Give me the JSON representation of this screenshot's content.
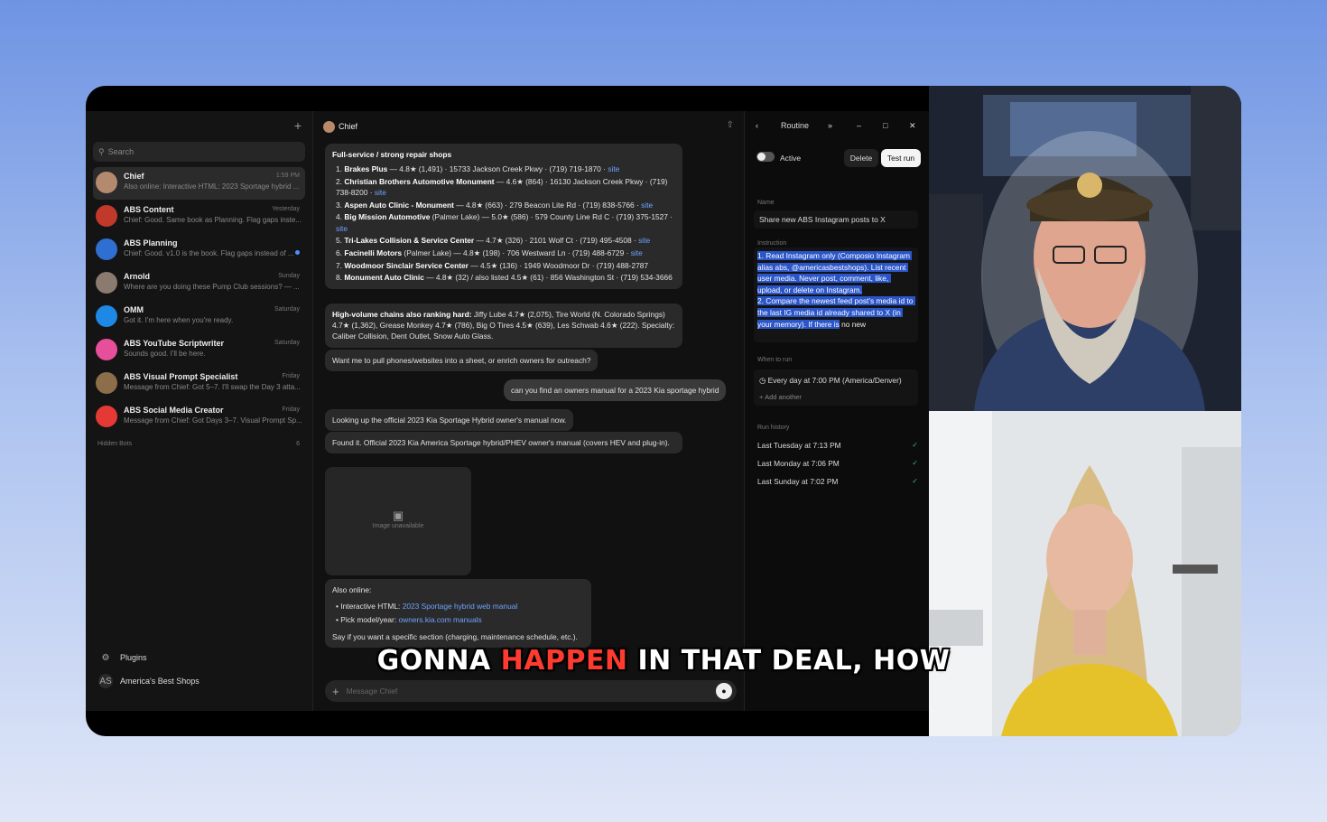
{
  "sidebar": {
    "search_placeholder": "Search",
    "chats": [
      {
        "name": "Chief",
        "preview": "Also online: Interactive HTML: 2023 Sportage hybrid ...",
        "time": "1:59 PM",
        "avatar_color": "#b48a6e"
      },
      {
        "name": "ABS Content",
        "preview": "Chief: Good. Same book as Planning. Flag gaps inste...",
        "time": "Yesterday",
        "avatar_color": "#c0392b"
      },
      {
        "name": "ABS Planning",
        "preview": "Chief: Good. v1.0 is the book. Flag gaps instead of ...",
        "time": "",
        "avatar_color": "#2f6fd1"
      },
      {
        "name": "Arnold",
        "preview": "Where are you doing these Pump Club sessions? — ...",
        "time": "Sunday",
        "avatar_color": "#8a7a70"
      },
      {
        "name": "OMM",
        "preview": "Got it. I'm here when you're ready.",
        "time": "Saturday",
        "avatar_color": "#1e88e5"
      },
      {
        "name": "ABS YouTube Scriptwriter",
        "preview": "Sounds good. I'll be here.",
        "time": "Saturday",
        "avatar_color": "#e84f9a"
      },
      {
        "name": "ABS Visual Prompt Specialist",
        "preview": "Message from Chief: Got 5–7. I'll swap the Day 3 atta...",
        "time": "Friday",
        "avatar_color": "#8d6e4a"
      },
      {
        "name": "ABS Social Media Creator",
        "preview": "Message from Chief: Got Days 3–7. Visual Prompt Sp...",
        "time": "Friday",
        "avatar_color": "#e53935"
      }
    ],
    "hidden_bots_label": "Hidden Bots",
    "hidden_bots_count": "6",
    "plugins_label": "Plugins",
    "org_initials": "AS",
    "org_name": "America's Best Shops"
  },
  "main": {
    "title": "Chief",
    "msg1": {
      "heading": "Full-service / strong repair shops",
      "items": [
        {
          "num": "1.",
          "name": "Brakes Plus",
          "detail": " — 4.8★ (1,491) · 15733 Jackson Creek Pkwy · (719) 719-1870 · ",
          "link": "site"
        },
        {
          "num": "2.",
          "name": "Christian Brothers Automotive Monument",
          "detail": " — 4.6★ (864) · 16130 Jackson Creek Pkwy · (719) 738-8200 · ",
          "link": "site"
        },
        {
          "num": "3.",
          "name": "Aspen Auto Clinic - Monument",
          "detail": " — 4.8★ (663) · 279 Beacon Lite Rd · (719) 838-5766 · ",
          "link": "site"
        },
        {
          "num": "4.",
          "name": "Big Mission Automotive",
          "detail": " (Palmer Lake) — 5.0★ (586) · 579 County Line Rd C · (719) 375-1527 · ",
          "link": "site"
        },
        {
          "num": "5.",
          "name": "Tri-Lakes Collision & Service Center",
          "detail": " — 4.7★ (326) · 2101 Wolf Ct · (719) 495-4508 · ",
          "link": "site"
        },
        {
          "num": "6.",
          "name": "Facinelli Motors",
          "detail": " (Palmer Lake) — 4.8★ (198) · 706 Westward Ln · (719) 488-6729 · ",
          "link": "site"
        },
        {
          "num": "7.",
          "name": "Woodmoor Sinclair Service Center",
          "detail": " — 4.5★ (136) · 1949 Woodmoor Dr · (719) 488-2787",
          "link": ""
        },
        {
          "num": "8.",
          "name": "Monument Auto Clinic",
          "detail": " — 4.8★ (32) / also listed 4.5★ (61) · 856 Washington St · (719) 534-3666",
          "link": ""
        }
      ]
    },
    "msg2_bold": "High-volume chains also ranking hard:",
    "msg2_text": " Jiffy Lube 4.7★ (2,075), Tire World (N. Colorado Springs) 4.7★ (1,362), Grease Monkey 4.7★ (786), Big O Tires 4.5★ (639), Les Schwab 4.6★ (222). Specialty: Caliber Collision, Dent Outlet, Snow Auto Glass.",
    "msg3": "Want me to pull phones/websites into a sheet, or enrich owners for outreach?",
    "user_msg": "can you find an owners manual for a 2023 Kia sportage hybrid",
    "msg4": "Looking up the official 2023 Kia Sportage Hybrid owner's manual now.",
    "msg5": "Found it. Official 2023 Kia America Sportage hybrid/PHEV owner's manual (covers HEV and plug-in).",
    "image_unavailable": "Image unavailable",
    "msg6": {
      "heading": "Also online:",
      "item1_label": "Interactive HTML: ",
      "item1_link": "2023 Sportage hybrid web manual",
      "item2_label": "Pick model/year: ",
      "item2_link": "owners.kia.com manuals",
      "footer": "Say if you want a specific section (charging, maintenance schedule, etc.)."
    },
    "composer_placeholder": "Message Chief"
  },
  "routine": {
    "title": "Routine",
    "active_label": "Active",
    "delete_label": "Delete",
    "test_run_label": "Test run",
    "name_label": "Name",
    "name_value": "Share new ABS Instagram posts to X",
    "instruction_label": "Instruction",
    "instruction_selected": "1. Read Instagram only (Composio Instagram alias abs, @americasbestshops). List recent user media. Never post, comment, like, upload, or delete on Instagram.\n2. Compare the newest feed post's media id to the last IG media id already shared to X (in your memory). If there is",
    "instruction_rest": " no new",
    "when_label": "When to run",
    "schedule": "Every day at 7:00 PM (America/Denver)",
    "add_another": "Add another",
    "history_label": "Run history",
    "history": [
      "Last Tuesday at 7:13 PM",
      "Last Monday at 7:06 PM",
      "Last Sunday at 7:02 PM"
    ]
  },
  "caption": {
    "pre": "GONNA ",
    "highlight": "HAPPEN",
    "post": " IN THAT DEAL, HOW"
  },
  "colors": {
    "accent_link": "#6fa3ff",
    "selection": "#2b56c9",
    "caption_highlight": "#ff3b30"
  }
}
